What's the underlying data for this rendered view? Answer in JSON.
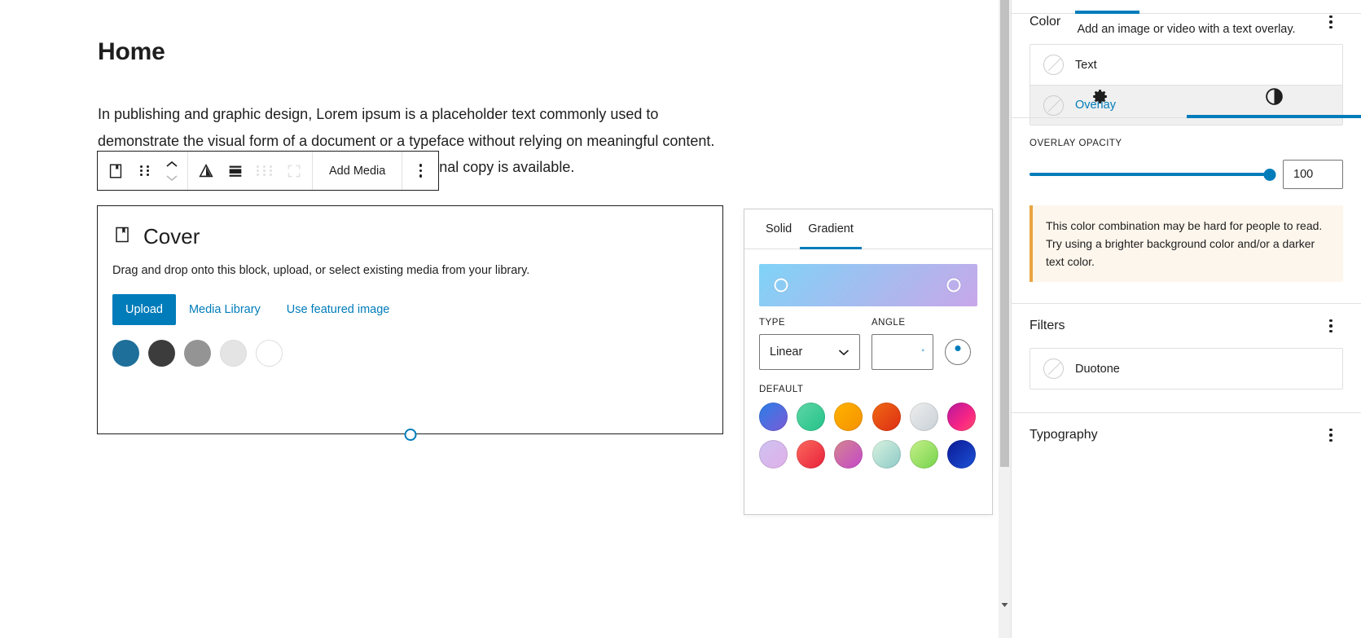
{
  "editor": {
    "post_title": "Home",
    "paragraph": "In publishing and graphic design, Lorem ipsum is a placeholder text commonly used to demonstrate the visual form of a document or a typeface without relying on meaningful content. Lorem ipsum may be used as a placeholder before final copy is available.",
    "toolbar": {
      "block_type_icon": "cover-block-icon",
      "drag_handle_icon": "drag-handle-icon",
      "move_up_icon": "chevron-up-icon",
      "move_down_icon": "chevron-down-icon",
      "change_content_position_icon": "content-position-icon",
      "align_icon": "align-icon",
      "drag_disabled_icon": "drag-handle-disabled-icon",
      "fullwidth_icon": "full-width-icon",
      "add_media_label": "Add Media",
      "more_options_icon": "ellipsis-vertical-icon"
    }
  },
  "cover_block": {
    "icon": "cover-block-icon",
    "title": "Cover",
    "description": "Drag and drop onto this block, upload, or select existing media from your library.",
    "upload_label": "Upload",
    "media_library_label": "Media Library",
    "use_featured_label": "Use featured image",
    "accent_color": "#007cba",
    "color_dots": [
      {
        "name": "blue",
        "hex": "#1e6f9a"
      },
      {
        "name": "dark-gray",
        "hex": "#3c3c3c"
      },
      {
        "name": "gray",
        "hex": "#949494"
      },
      {
        "name": "light-gray",
        "hex": "#e4e4e4"
      },
      {
        "name": "white",
        "hex": "#ffffff"
      }
    ]
  },
  "gradient_popover": {
    "tabs": [
      {
        "id": "solid",
        "label": "Solid",
        "active": false
      },
      {
        "id": "gradient",
        "label": "Gradient",
        "active": true
      }
    ],
    "preview_gradient": "linear-gradient(135deg, #7fd3f7 0%, #c8a7e9 100%)",
    "stops": [
      {
        "position_pct": 10,
        "label": "gradient-stop-start"
      },
      {
        "position_pct": 89,
        "label": "gradient-stop-end"
      }
    ],
    "type_label": "TYPE",
    "type_value": "Linear",
    "angle_label": "ANGLE",
    "angle_value": "",
    "angle_unit": "°",
    "default_label": "DEFAULT",
    "swatches": [
      {
        "name": "vivid-cyan-blue-to-vivid-purple",
        "css": "linear-gradient(135deg, #2a7ee8 0%, #7b5bd6 100%)"
      },
      {
        "name": "light-green-cyan-to-vivid-green-cyan",
        "css": "linear-gradient(135deg, #5fd6a6 0%, #23c288 100%)"
      },
      {
        "name": "luminous-vivid-amber-to-luminous-vivid-orange",
        "css": "linear-gradient(135deg, #ffb300 0%, #f59100 100%)"
      },
      {
        "name": "luminous-vivid-orange-to-vivid-red",
        "css": "linear-gradient(135deg, #f06a13 0%, #dd2c14 100%)"
      },
      {
        "name": "very-light-gray-to-cyan-bluish-gray",
        "css": "linear-gradient(135deg, #eeeeee 0%, #c8d0d6 100%)"
      },
      {
        "name": "cool-to-warm-spectrum",
        "css": "linear-gradient(135deg, #b5179e 0%, #f72585 60%, #ff4d6d 100%)"
      },
      {
        "name": "blush-light-purple",
        "css": "linear-gradient(135deg, #cfc2f2 0%, #dfb0e8 100%)"
      },
      {
        "name": "blush-bordeaux",
        "css": "linear-gradient(135deg, #fb6a5e 0%, #e8203a 100%)"
      },
      {
        "name": "luminous-dusk",
        "css": "linear-gradient(135deg, #d4868f 0%, #c447c9 100%)"
      },
      {
        "name": "pale-ocean",
        "css": "linear-gradient(135deg, #d9f3e0 0%, #8cc9c6 100%)"
      },
      {
        "name": "electric-grass",
        "css": "linear-gradient(135deg, #c7f08a 0%, #74d34a 100%)"
      },
      {
        "name": "midnight",
        "css": "linear-gradient(135deg, #0b1a96 0%, #1c51d6 100%)"
      }
    ]
  },
  "sidebar": {
    "block_description": "Add an image or video with a text overlay.",
    "tabs": [
      {
        "id": "settings",
        "icon": "gear-icon",
        "active": false
      },
      {
        "id": "styles",
        "icon": "contrast-icon",
        "active": true
      }
    ],
    "color_section": {
      "title": "Color",
      "more_icon": "ellipsis-vertical-icon",
      "rows": [
        {
          "label": "Text",
          "selected": false,
          "swatch_icon": "no-color-icon"
        },
        {
          "label": "Overlay",
          "selected": true,
          "swatch_icon": "no-color-icon"
        }
      ],
      "opacity_label": "OVERLAY OPACITY",
      "opacity_value": "100",
      "opacity_pct": 100,
      "slider_color": "#007cba"
    },
    "notice": {
      "text": "This color combination may be hard for people to read. Try using a brighter background color and/or a darker text color.",
      "bg": "#fdf6ec",
      "accent": "#e9a540"
    },
    "filters_section": {
      "title": "Filters",
      "more_icon": "ellipsis-vertical-icon",
      "rows": [
        {
          "label": "Duotone",
          "swatch_icon": "no-color-icon"
        }
      ]
    },
    "typography_section": {
      "title": "Typography",
      "more_icon": "ellipsis-vertical-icon"
    }
  }
}
